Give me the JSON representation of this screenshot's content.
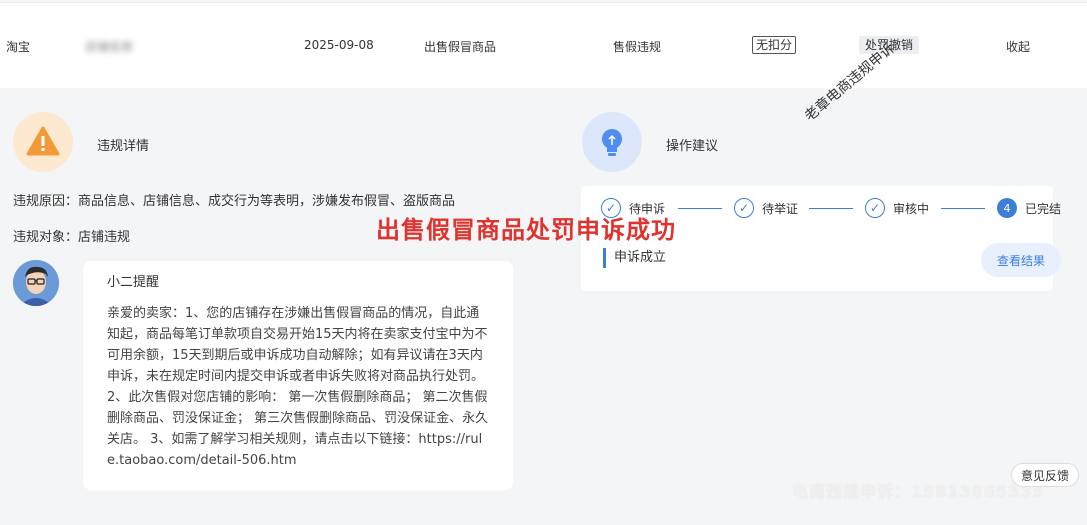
{
  "record": {
    "platform": "淘宝",
    "shop_name": "店铺名称",
    "date": "2025-09-08",
    "violation_type": "出售假冒商品",
    "category": "售假违规",
    "deduction": "无扣分",
    "status": "处罚撤销",
    "collapse_label": "收起"
  },
  "violation_details": {
    "title": "违规详情",
    "reason_label": "违规原因：",
    "reason_value": "商品信息、店铺信息、成交行为等表明，涉嫌发布假冒、盗版商品",
    "target_label": "违规对象：",
    "target_value": "店铺违规"
  },
  "reminder": {
    "title": "小二提醒",
    "text": "亲爱的卖家：1、您的店铺存在涉嫌出售假冒商品的情况，自此通知起，商品每笔订单款项自交易开始15天内将在卖家支付宝中为不可用余额，15天到期后或申诉成功自动解除；如有异议请在3天内申诉，未在规定时间内提交申诉或者申诉失败将对商品执行处罚。2、此次售假对您店铺的影响： 第一次售假删除商品； 第二次售假删除商品、罚没保证金； 第三次售假删除商品、罚没保证金、永久关店。 3、如需了解学习相关规则，请点击以下链接：https://rule.taobao.com/detail-506.htm"
  },
  "suggestions": {
    "title": "操作建议",
    "steps": [
      {
        "label": "待申诉",
        "icon": "check"
      },
      {
        "label": "待举证",
        "icon": "check"
      },
      {
        "label": "审核中",
        "icon": "check"
      },
      {
        "label": "已完结",
        "number": "4"
      }
    ],
    "result_text": "申诉成立",
    "result_button": "查看结果"
  },
  "overlay": {
    "headline": "出售假冒商品处罚申诉成功",
    "watermark_diagonal": "老章电商违规申诉",
    "watermark_bottom": "电商违规申诉：15813865335"
  },
  "feedback_label": "意见反馈",
  "colors": {
    "accent": "#3d7fd8",
    "headline": "#e0332f",
    "warning": "#f29a38"
  }
}
